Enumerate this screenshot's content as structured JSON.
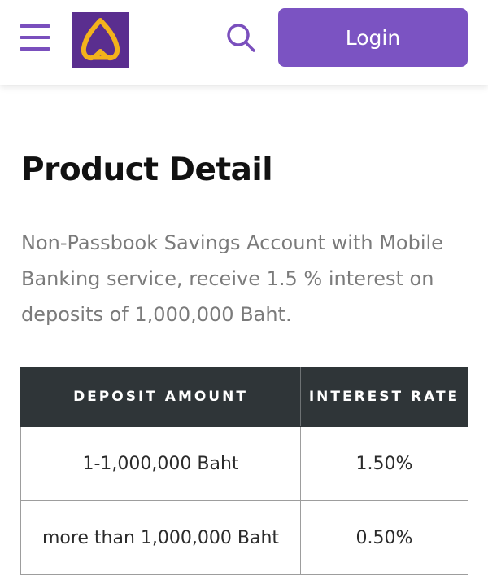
{
  "header": {
    "menu_icon": "hamburger-menu-icon",
    "logo_icon": "bank-logo-icon",
    "search_icon": "search-icon",
    "login_label": "Login",
    "accent_color": "#7b53c2",
    "logo_bg_color": "#5a2e8f",
    "logo_fg_color": "#f3b21b"
  },
  "main": {
    "title": "Product Detail",
    "description": "Non-Passbook Savings Account with Mobile Banking service, receive 1.5 % interest on deposits of 1,000,000 Baht."
  },
  "table": {
    "header_bg_color": "#2f3538",
    "columns": [
      "DEPOSIT AMOUNT",
      "INTEREST RATE"
    ],
    "rows": [
      [
        "1-1,000,000 Baht",
        "1.50%"
      ],
      [
        "more than 1,000,000 Baht",
        "0.50%"
      ]
    ]
  }
}
